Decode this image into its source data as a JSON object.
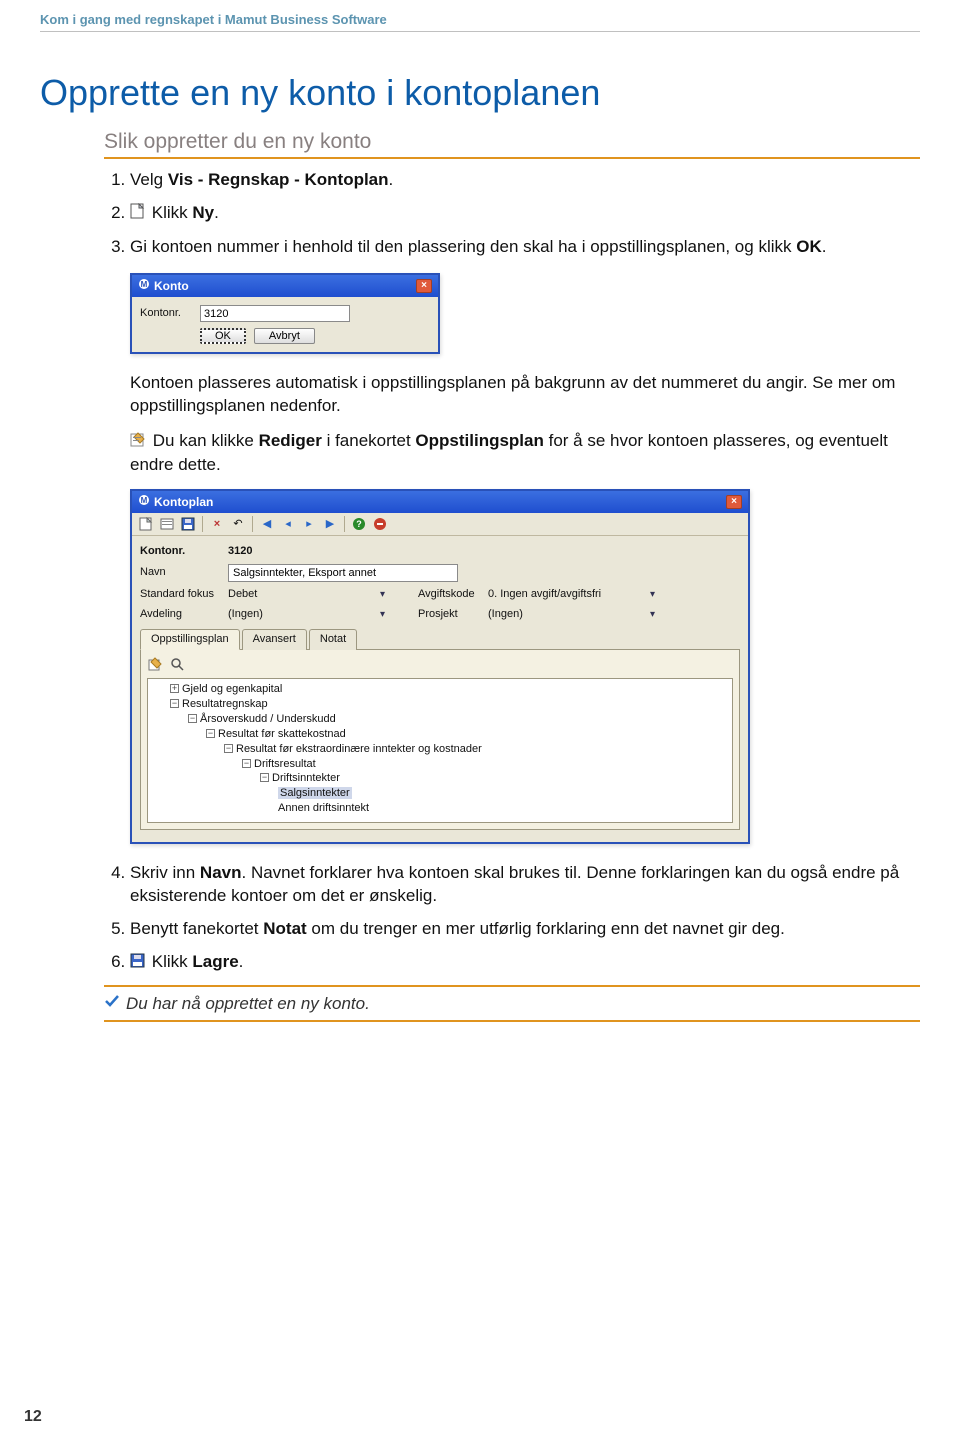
{
  "header": "Kom i gang med regnskapet i Mamut Business Software",
  "title": "Opprette en ny konto i kontoplanen",
  "subtitle": "Slik oppretter du en ny konto",
  "steps": {
    "s1_a": "Velg ",
    "s1_b": "Vis - Regnskap - Kontoplan",
    "s1_c": ".",
    "s2_a": "Klikk ",
    "s2_b": "Ny",
    "s2_c": ".",
    "s3_a": "Gi kontoen nummer i henhold til den plassering den skal ha i oppstillingsplanen, og klikk ",
    "s3_b": "OK",
    "s3_c": "."
  },
  "dlgKonto": {
    "title": "Konto",
    "label": "Kontonr.",
    "value": "3120",
    "ok": "OK",
    "cancel": "Avbryt"
  },
  "para1": "Kontoen plasseres automatisk i oppstillingsplanen på bakgrunn av det nummeret du angir. Se mer om oppstillingsplanen nedenfor.",
  "para2_a": "Du kan klikke ",
  "para2_b": "Rediger",
  "para2_c": " i fanekortet ",
  "para2_d": "Oppstilingsplan",
  "para2_e": " for å se hvor kontoen plasseres, og eventuelt endre dette.",
  "dlgKP": {
    "title": "Kontoplan",
    "lbl_kontonr": "Kontonr.",
    "val_kontonr": "3120",
    "lbl_navn": "Navn",
    "val_navn": "Salgsinntekter, Eksport annet",
    "lbl_fokus": "Standard fokus",
    "val_fokus": "Debet",
    "lbl_avg": "Avgiftskode",
    "val_avg": "0. Ingen avgift/avgiftsfri",
    "lbl_avd": "Avdeling",
    "val_avd": "(Ingen)",
    "lbl_pro": "Prosjekt",
    "val_pro": "(Ingen)",
    "tab1": "Oppstillingsplan",
    "tab2": "Avansert",
    "tab3": "Notat",
    "tree": {
      "n1": "Gjeld og egenkapital",
      "n2": "Resultatregnskap",
      "n3": "Årsoverskudd / Underskudd",
      "n4": "Resultat før skattekostnad",
      "n5": "Resultat før ekstraordinære inntekter og kostnader",
      "n6": "Driftsresultat",
      "n7": "Driftsinntekter",
      "n8": "Salgsinntekter",
      "n9": "Annen driftsinntekt"
    }
  },
  "steps2": {
    "s4_a": "Skriv inn ",
    "s4_b": "Navn",
    "s4_c": ". Navnet forklarer hva kontoen skal brukes til. Denne forklaringen kan du også endre på eksisterende kontoer om det er ønskelig.",
    "s5_a": "Benytt fanekortet ",
    "s5_b": "Notat",
    "s5_c": " om du trenger en mer utførlig forklaring enn det navnet gir deg.",
    "s6_a": "Klikk ",
    "s6_b": "Lagre",
    "s6_c": "."
  },
  "done": "Du har nå opprettet en ny konto.",
  "page": "12"
}
